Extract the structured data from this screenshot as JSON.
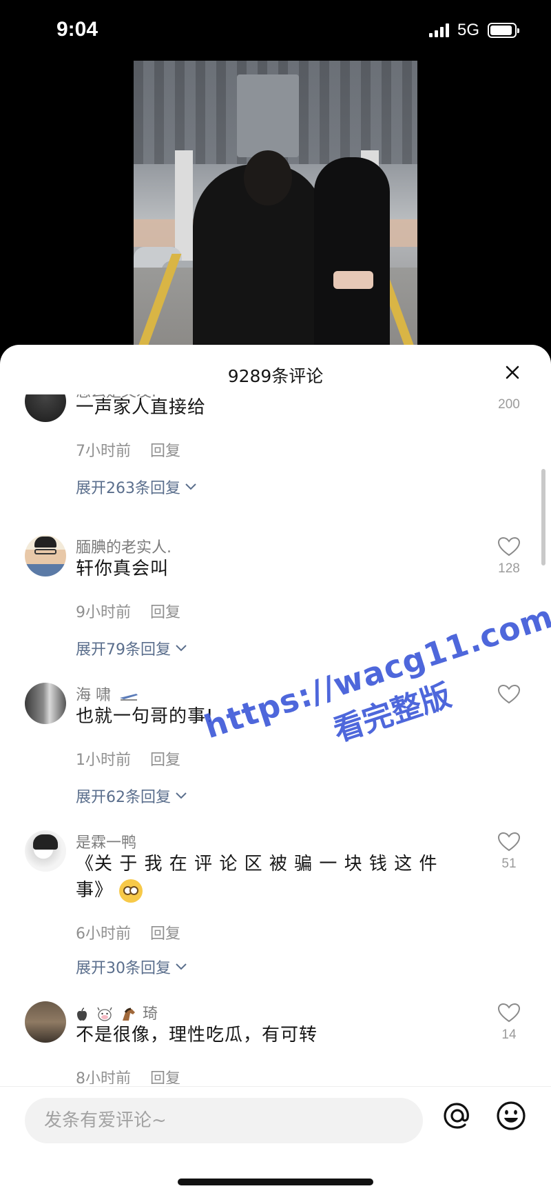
{
  "status_bar": {
    "time": "9:04",
    "network": "5G",
    "battery_level": 0.9
  },
  "sheet": {
    "title": "9289条评论",
    "close_icon": "close-icon"
  },
  "comments": [
    {
      "username": "怎么是又发.",
      "text": "一声家人直接给",
      "time": "7小时前",
      "reply": "回复",
      "expand": "展开263条回复",
      "likes": "200"
    },
    {
      "username": "腼腆的老实人.",
      "text": "轩你真会叫",
      "time": "9小时前",
      "reply": "回复",
      "expand": "展开79条回复",
      "likes": "128"
    },
    {
      "username": "海 啸",
      "text": "也就一句哥的事!",
      "time": "1小时前",
      "reply": "回复",
      "expand": "展开62条回复",
      "likes": ""
    },
    {
      "username": "是霖一鸭",
      "text": "《关 于 我 在 评 论 区 被 骗 一 块 钱 这 件 事》",
      "time": "6小时前",
      "reply": "回复",
      "expand": "展开30条回复",
      "likes": "51"
    },
    {
      "username": "琦",
      "text": "不是很像，理性吃瓜，有可转",
      "time": "8小时前",
      "reply": "回复",
      "likes": "14"
    }
  ],
  "watermark": {
    "url": "https://wacg11.com",
    "subtitle": "看完整版"
  },
  "footer": {
    "placeholder": "发条有爱评论~"
  },
  "colors": {
    "accent_link": "#5a6e8c",
    "watermark": "#3b57d8"
  }
}
